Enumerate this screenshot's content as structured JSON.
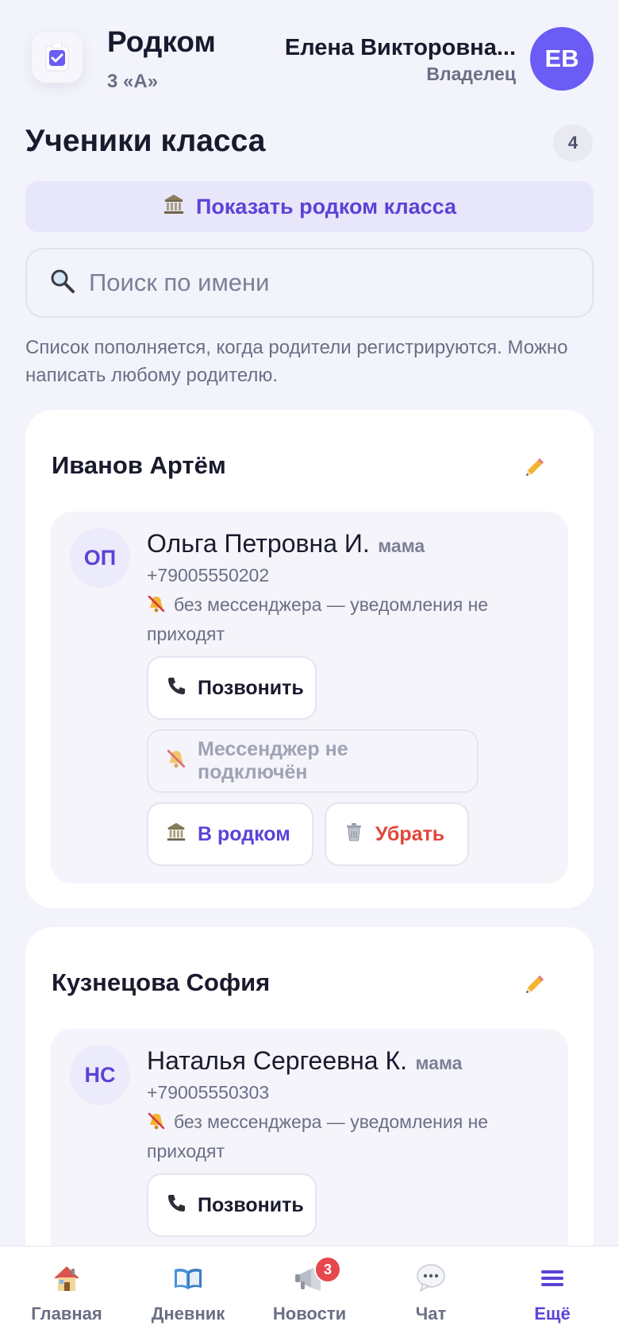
{
  "header": {
    "app_title": "Родком",
    "class_name": "3 «А»",
    "user_name": "Елена Викторовна...",
    "user_role": "Владелец",
    "user_initials": "ЕВ"
  },
  "section": {
    "title": "Ученики класса",
    "count": "4",
    "show_rodkom_label": "Показать родком класса",
    "search_placeholder": "Поиск по имени",
    "hint": "Список пополняется, когда родители регистрируются. Можно написать любому родителю."
  },
  "students": [
    {
      "name": "Иванов Артём",
      "parent": {
        "initials": "ОП",
        "name": "Ольга Петровна И.",
        "relation": "мама",
        "phone": "+79005550202",
        "status": "без мессенджера — уведомления не приходят"
      },
      "buttons": {
        "call": "Позвонить",
        "messenger": "Мессенджер не подключён",
        "rodkom": "В родком",
        "remove": "Убрать"
      }
    },
    {
      "name": "Кузнецова София",
      "parent": {
        "initials": "НС",
        "name": "Наталья Сергеевна К.",
        "relation": "мама",
        "phone": "+79005550303",
        "status": "без мессенджера — уведомления не приходят"
      },
      "buttons": {
        "call": "Позвонить"
      }
    }
  ],
  "tabbar": {
    "items": [
      {
        "label": "Главная",
        "icon": "house-icon"
      },
      {
        "label": "Дневник",
        "icon": "book-icon"
      },
      {
        "label": "Новости",
        "icon": "megaphone-icon",
        "badge": "3"
      },
      {
        "label": "Чат",
        "icon": "speech-bubble-icon"
      },
      {
        "label": "Ещё",
        "icon": "menu-icon",
        "active": true
      }
    ]
  },
  "colors": {
    "accent": "#6a5cf5",
    "accent_text": "#5b43d6",
    "danger": "#e0453a",
    "background": "#f3f3fb"
  }
}
